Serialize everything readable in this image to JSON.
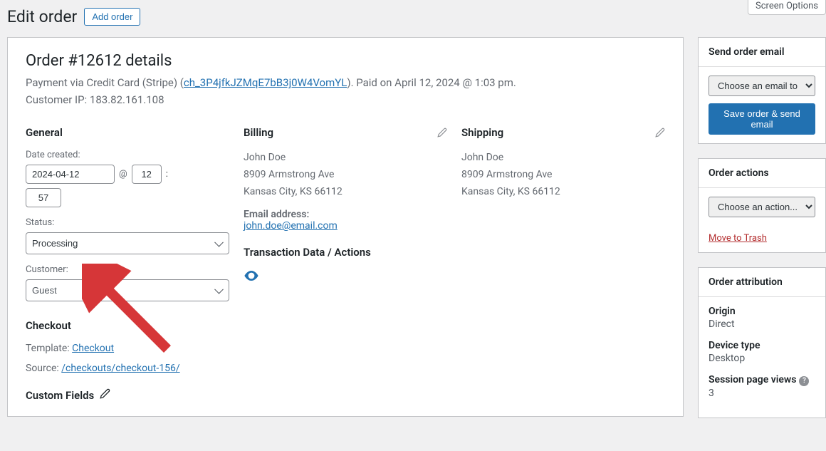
{
  "header": {
    "screen_options": "Screen Options",
    "title": "Edit order",
    "add_order_btn": "Add order"
  },
  "order": {
    "title": "Order #12612 details",
    "payment_prefix": "Payment via Credit Card (Stripe) (",
    "payment_link": "ch_3P4jfkJZMqE7bB3j0W4VomYL",
    "payment_suffix": "). Paid on April 12, 2024 @ 1:03 pm.",
    "customer_ip_label": "Customer IP: ",
    "customer_ip": "183.82.161.108"
  },
  "general": {
    "heading": "General",
    "date_label": "Date created:",
    "date": "2024-04-12",
    "at": "@",
    "hour": "12",
    "colon": ":",
    "minute": "57",
    "status_label": "Status:",
    "status_value": "Processing",
    "customer_label": "Customer:",
    "customer_value": "Guest",
    "checkout_heading": "Checkout",
    "template_label": "Template: ",
    "template_link": "Checkout",
    "source_label": "Source: ",
    "source_link": "/checkouts/checkout-156/",
    "custom_fields": "Custom Fields"
  },
  "billing": {
    "heading": "Billing",
    "name": "John Doe",
    "street": "8909 Armstrong Ave",
    "city": "Kansas City, KS 66112",
    "email_label": "Email address:",
    "email": "john.doe@email.com",
    "transaction_heading": "Transaction Data / Actions"
  },
  "shipping": {
    "heading": "Shipping",
    "name": "John Doe",
    "street": "8909 Armstrong Ave",
    "city": "Kansas City, KS 66112"
  },
  "side_email": {
    "heading": "Send order email",
    "placeholder": "Choose an email to send",
    "button": "Save order & send email"
  },
  "side_actions": {
    "heading": "Order actions",
    "placeholder": "Choose an action...",
    "trash": "Move to Trash"
  },
  "side_attr": {
    "heading": "Order attribution",
    "origin_label": "Origin",
    "origin_value": "Direct",
    "device_label": "Device type",
    "device_value": "Desktop",
    "session_label": "Session page views",
    "session_value": "3"
  }
}
